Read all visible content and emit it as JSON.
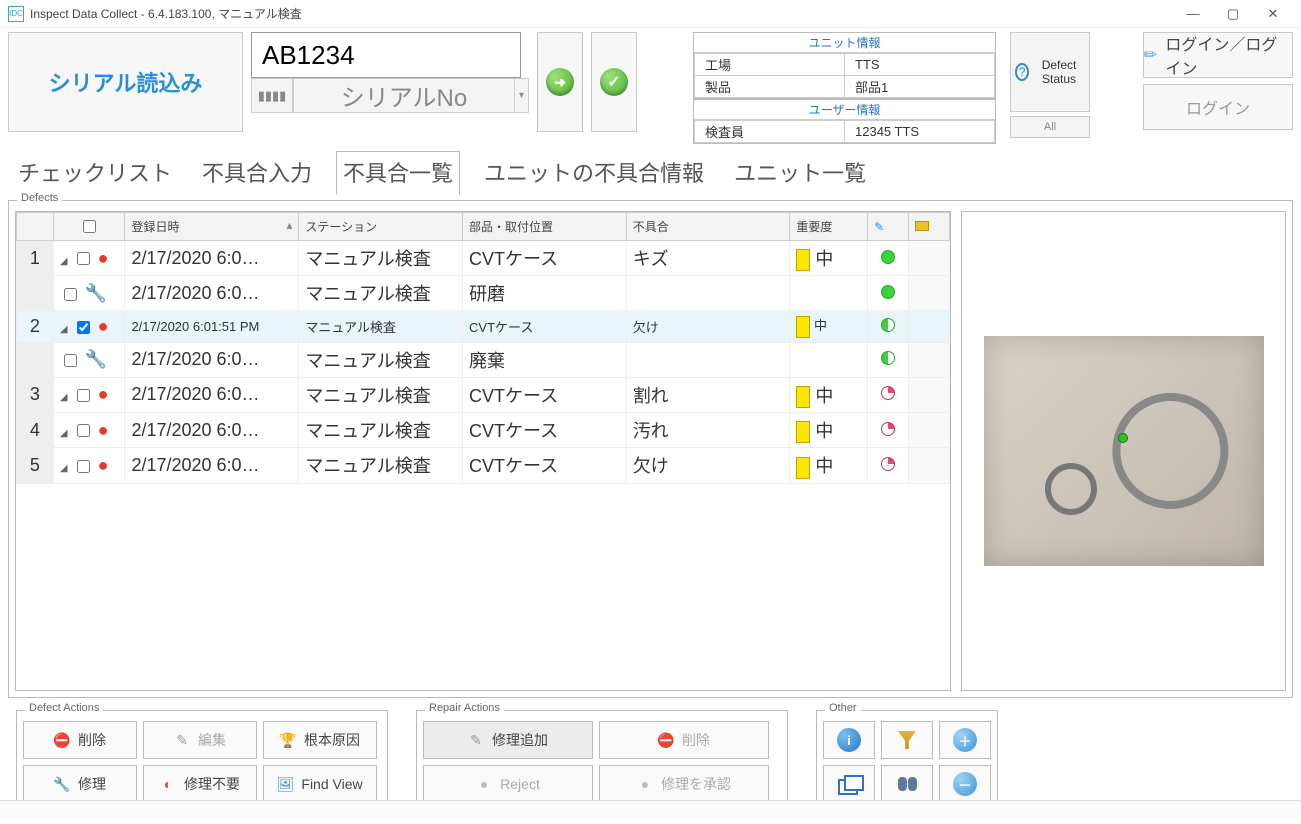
{
  "window": {
    "title": "Inspect Data Collect - 6.4.183.100, マニュアル検査",
    "minimize": "—",
    "maximize": "▢",
    "close": "✕",
    "icon_text": "IDC"
  },
  "top": {
    "serial_load_btn": "シリアル読込み",
    "serial_value": "AB1234",
    "serial_placeholder": "シリアルNo",
    "ok_check": "✓"
  },
  "info": {
    "unit_header": "ユニット情報",
    "factory_label": "工場",
    "factory_value": "TTS",
    "product_label": "製品",
    "product_value": "部品1",
    "user_header": "ユーザー情報",
    "inspector_label": "検査員",
    "inspector_value": "12345 TTS"
  },
  "defect_status_btn": "Defect Status",
  "all_btn": "All",
  "login": {
    "login_logout": "ログイン／ログイン",
    "login": "ログイン"
  },
  "tabs": {
    "t1": "チェックリスト",
    "t2": "不具合入力",
    "t3": "不具合一覧",
    "t4": "ユニットの不具合情報",
    "t5": "ユニット一覧"
  },
  "defects": {
    "legend": "Defects",
    "headers": {
      "datetime": "登録日時",
      "station": "ステーション",
      "part": "部品・取付位置",
      "defect": "不具合",
      "severity": "重要度"
    },
    "rows": [
      {
        "num": "1",
        "chk": false,
        "icon": "excl",
        "datetime": "2/17/2020 6:0…",
        "station": "マニュアル検査",
        "part": "CVTケース",
        "defect": "キズ",
        "sev": "中",
        "sevbox": true,
        "dot": "green"
      },
      {
        "num": "",
        "chk": false,
        "icon": "wrench",
        "datetime": "2/17/2020 6:0…",
        "station": "マニュアル検査",
        "part": "研磨",
        "defect": "",
        "sev": "",
        "sevbox": false,
        "dot": "green"
      },
      {
        "num": "2",
        "chk": true,
        "icon": "excl",
        "datetime": "2/17/2020 6:01:51 PM",
        "station": "マニュアル検査",
        "part": "CVTケース",
        "defect": "欠け",
        "sev": "中",
        "sevbox": true,
        "dot": "qtr-g",
        "selected": true,
        "small": true
      },
      {
        "num": "",
        "chk": false,
        "icon": "wrench",
        "datetime": "2/17/2020 6:0…",
        "station": "マニュアル検査",
        "part": "廃棄",
        "defect": "",
        "sev": "",
        "sevbox": false,
        "dot": "half-g"
      },
      {
        "num": "3",
        "chk": false,
        "icon": "excl",
        "datetime": "2/17/2020 6:0…",
        "station": "マニュアル検査",
        "part": "CVTケース",
        "defect": "割れ",
        "sev": "中",
        "sevbox": true,
        "dot": "qtr-r"
      },
      {
        "num": "4",
        "chk": false,
        "icon": "excl",
        "datetime": "2/17/2020 6:0…",
        "station": "マニュアル検査",
        "part": "CVTケース",
        "defect": "汚れ",
        "sev": "中",
        "sevbox": true,
        "dot": "qtr-r"
      },
      {
        "num": "5",
        "chk": false,
        "icon": "excl",
        "datetime": "2/17/2020 6:0…",
        "station": "マニュアル検査",
        "part": "CVTケース",
        "defect": "欠け",
        "sev": "中",
        "sevbox": true,
        "dot": "qtr-r"
      }
    ]
  },
  "actions": {
    "defect_legend": "Defect Actions",
    "repair_legend": "Repair Actions",
    "other_legend": "Other",
    "delete": "削除",
    "edit": "編集",
    "root_cause": "根本原因",
    "repair": "修理",
    "no_repair": "修理不要",
    "find_view": "Find View",
    "add_repair": "修理追加",
    "r_delete": "削除",
    "reject": "Reject",
    "approve": "修理を承認"
  }
}
